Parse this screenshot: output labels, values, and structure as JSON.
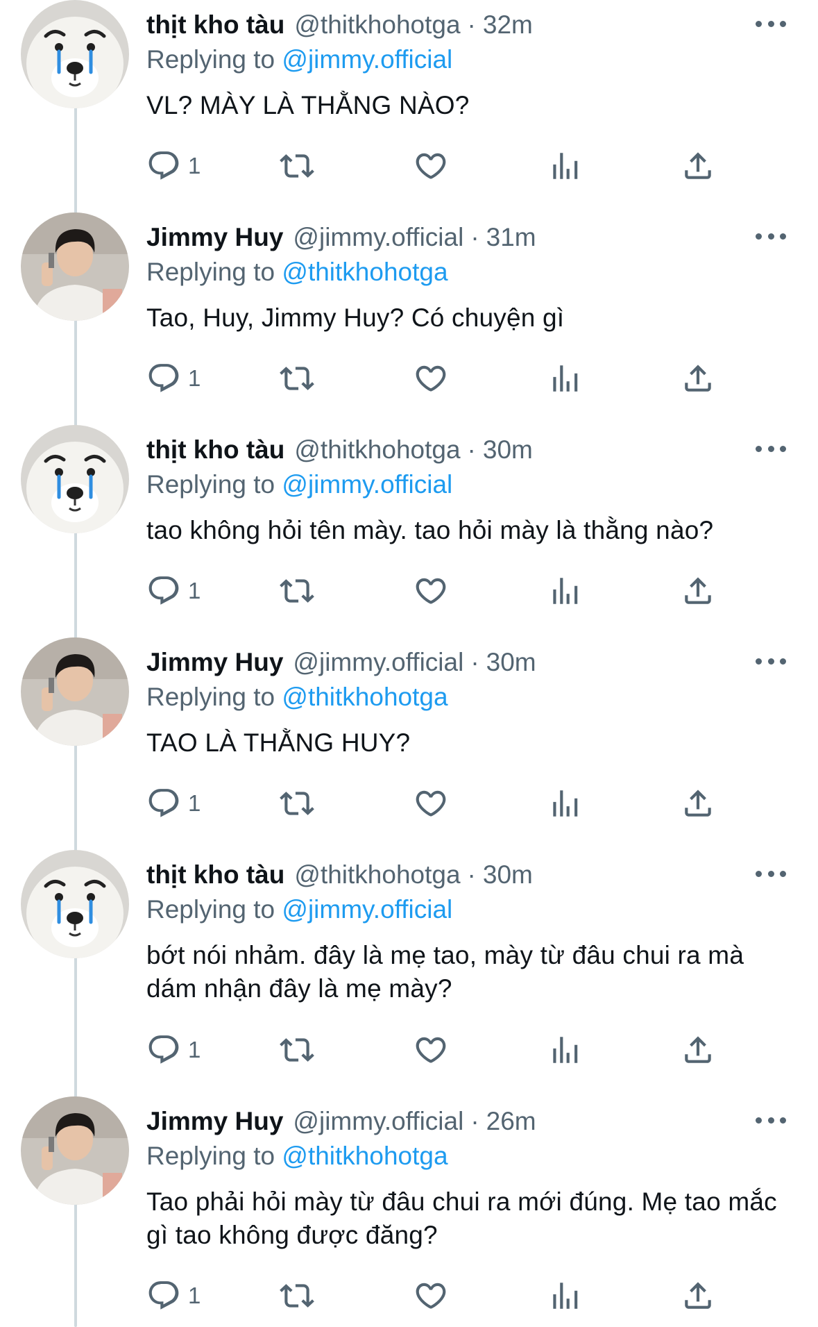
{
  "tweets": [
    {
      "name": "thịt kho tàu",
      "handle": "@thitkhohotga",
      "time": "32m",
      "replying_prefix": "Replying to",
      "replying_to": "@jimmy.official",
      "text": "VL? MÀY LÀ THẰNG NÀO?",
      "reply_count": "1",
      "avatar": "dog-avatar"
    },
    {
      "name": "Jimmy Huy",
      "handle": "@jimmy.official",
      "time": "31m",
      "replying_prefix": "Replying to",
      "replying_to": "@thitkhohotga",
      "text": "Tao, Huy, Jimmy Huy? Có chuyện gì",
      "reply_count": "1",
      "avatar": "person-avatar"
    },
    {
      "name": "thịt kho tàu",
      "handle": "@thitkhohotga",
      "time": "30m",
      "replying_prefix": "Replying to",
      "replying_to": "@jimmy.official",
      "text": "tao không hỏi tên mày. tao hỏi mày là thằng nào?",
      "reply_count": "1",
      "avatar": "dog-avatar"
    },
    {
      "name": "Jimmy Huy",
      "handle": "@jimmy.official",
      "time": "30m",
      "replying_prefix": "Replying to",
      "replying_to": "@thitkhohotga",
      "text": "TAO LÀ THẰNG HUY?",
      "reply_count": "1",
      "avatar": "person-avatar"
    },
    {
      "name": "thịt kho tàu",
      "handle": "@thitkhohotga",
      "time": "30m",
      "replying_prefix": "Replying to",
      "replying_to": "@jimmy.official",
      "text": "bớt nói nhảm. đây là mẹ tao, mày từ đâu chui ra mà dám nhận đây là mẹ mày?",
      "reply_count": "1",
      "avatar": "dog-avatar"
    },
    {
      "name": "Jimmy Huy",
      "handle": "@jimmy.official",
      "time": "26m",
      "replying_prefix": "Replying to",
      "replying_to": "@thitkhohotga",
      "text": "Tao phải hỏi mày từ đâu chui ra mới đúng. Mẹ tao mắc gì tao không được đăng?",
      "reply_count": "1",
      "avatar": "person-avatar"
    }
  ],
  "colors": {
    "accent": "#1d9bf0",
    "secondary_text": "#536471",
    "primary_text": "#0f1419",
    "thread_line": "#cfd9de"
  },
  "icons": {
    "reply": "reply-icon",
    "retweet": "retweet-icon",
    "like": "heart-icon",
    "analytics": "analytics-icon",
    "share": "share-icon",
    "more": "more-icon"
  }
}
